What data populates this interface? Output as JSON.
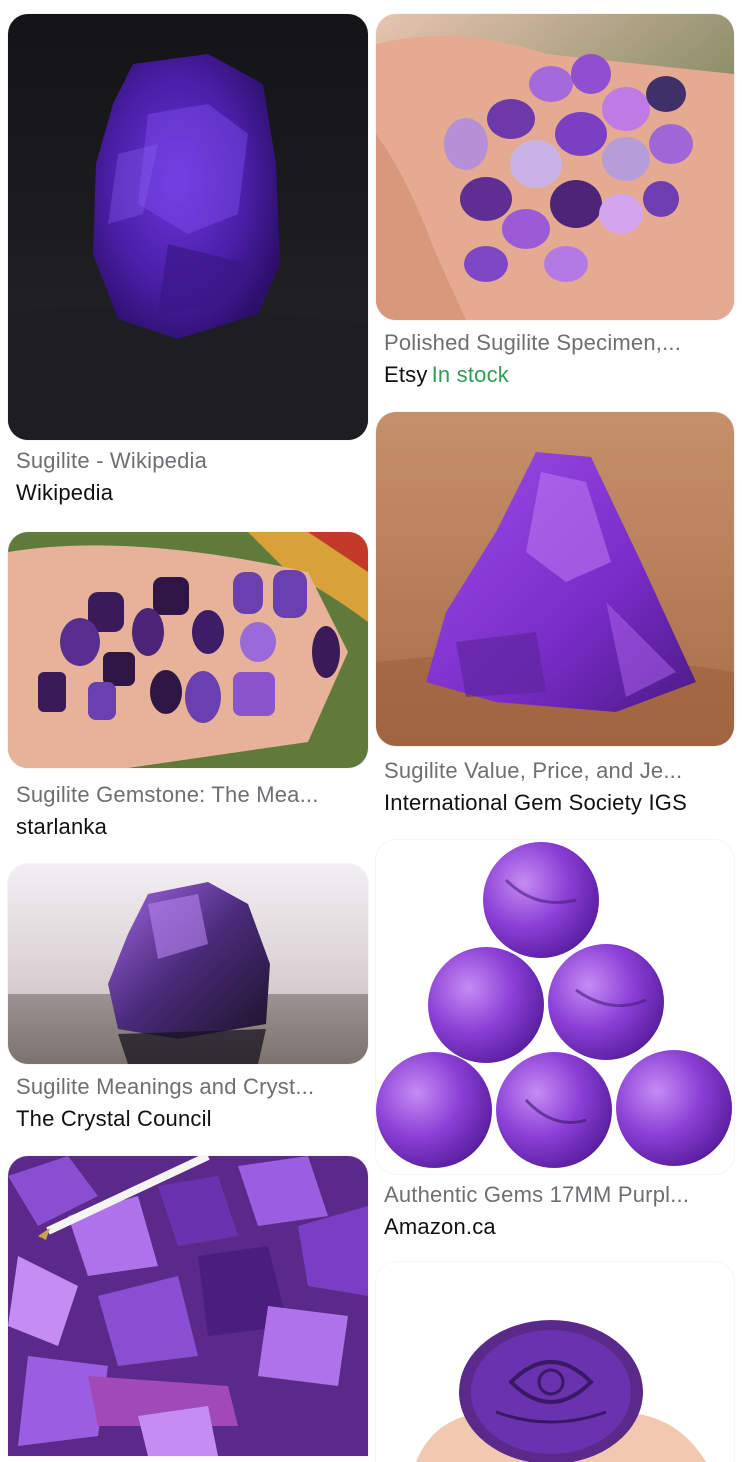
{
  "results": [
    {
      "title": "Sugilite - Wikipedia",
      "source": "Wikipedia",
      "image": "rough purple sugilite specimen on black cloth"
    },
    {
      "title": "Polished Sugilite Specimen,...",
      "source": "Etsy",
      "stock": "In stock",
      "image": "hand holding tumbled sugilite stones"
    },
    {
      "title": "Sugilite Value, Price, and Je...",
      "source": "International Gem Society IGS",
      "image": "rough sugilite on red sand"
    },
    {
      "title": "Sugilite Gemstone: The Mea...",
      "source": "starlanka",
      "image": "hand holding polished sugilite cabochons"
    },
    {
      "title": "Sugilite Meanings and Cryst...",
      "source": "The Crystal Council",
      "image": "sugilite specimen with reflection"
    },
    {
      "title": "Authentic Gems 17MM Purpl...",
      "source": "Amazon.ca",
      "image": "six round purple sugilite cabochons in a triangle"
    },
    {
      "title": "",
      "source": "",
      "image": "pile of rough sugilite chips with pen"
    },
    {
      "title": "",
      "source": "",
      "image": "carved sugilite oval stone on fingertips"
    }
  ],
  "colors": {
    "caption": "#6f6f73",
    "source": "#111111",
    "in_stock": "#2e9e4f",
    "sugilite": "#7b3fc4"
  }
}
